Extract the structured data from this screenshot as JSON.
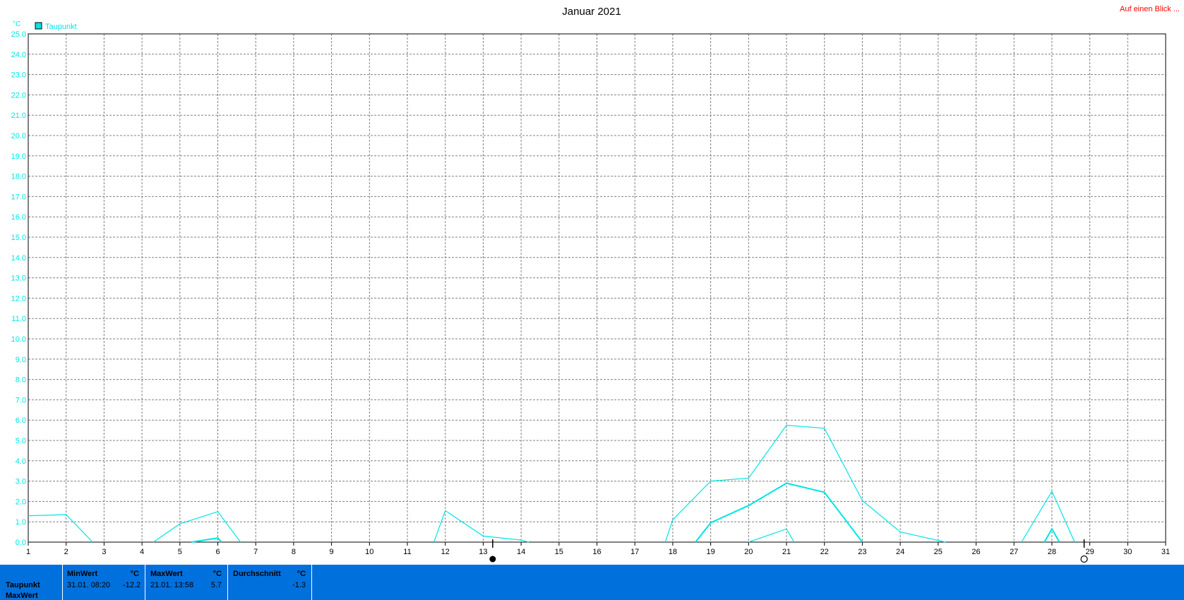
{
  "header": {
    "title": "Januar 2021",
    "link_label": "Auf einen Blick ..."
  },
  "chart_data": {
    "type": "line",
    "title": "Januar 2021",
    "ylabel": "°C",
    "xlabel": "",
    "ylim": [
      0,
      25
    ],
    "xlim": [
      1,
      31
    ],
    "grid": true,
    "legend": "top-left",
    "y_ticks": [
      "0.0",
      "1.0",
      "2.0",
      "3.0",
      "4.0",
      "5.0",
      "6.0",
      "7.0",
      "8.0",
      "9.0",
      "10.0",
      "11.0",
      "12.0",
      "13.0",
      "14.0",
      "15.0",
      "16.0",
      "17.0",
      "18.0",
      "19.0",
      "20.0",
      "21.0",
      "22.0",
      "23.0",
      "24.0",
      "25.0"
    ],
    "x_ticks": [
      "1",
      "2",
      "3",
      "4",
      "5",
      "6",
      "7",
      "8",
      "9",
      "10",
      "11",
      "12",
      "13",
      "14",
      "15",
      "16",
      "17",
      "18",
      "19",
      "20",
      "21",
      "22",
      "23",
      "24",
      "25",
      "26",
      "27",
      "28",
      "29",
      "30",
      "31"
    ],
    "moon_phases": [
      {
        "day": 13.25,
        "phase": "new-moon"
      },
      {
        "day": 28.85,
        "phase": "full-moon"
      }
    ],
    "series": [
      {
        "name": "Taupunkt",
        "color": "#00e5e5",
        "segments": [
          [
            [
              1,
              1.3
            ],
            [
              2,
              1.35
            ],
            [
              2.7,
              0
            ]
          ],
          [
            [
              4.3,
              0
            ],
            [
              5,
              0.9
            ],
            [
              6,
              1.5
            ],
            [
              6.6,
              0
            ]
          ],
          [
            [
              11.7,
              0
            ],
            [
              12,
              1.55
            ],
            [
              13,
              0.3
            ],
            [
              14,
              0.1
            ],
            [
              14.2,
              0
            ]
          ],
          [
            [
              17.8,
              0
            ],
            [
              18,
              1.1
            ],
            [
              19,
              3.0
            ],
            [
              20,
              3.15
            ],
            [
              21,
              5.75
            ],
            [
              22,
              5.6
            ],
            [
              23,
              2.05
            ],
            [
              24,
              0.5
            ],
            [
              25.2,
              0
            ]
          ],
          [
            [
              27.2,
              0
            ],
            [
              28,
              2.5
            ],
            [
              28.6,
              0
            ]
          ]
        ]
      },
      {
        "name": "",
        "color": "#00e5e5",
        "segments": [
          [
            [
              5.3,
              0
            ],
            [
              6,
              0.2
            ],
            [
              6.1,
              0
            ]
          ],
          [
            [
              18.6,
              0
            ],
            [
              19,
              0.95
            ],
            [
              20,
              1.8
            ],
            [
              21,
              2.9
            ],
            [
              22,
              2.45
            ],
            [
              23,
              0
            ]
          ],
          [
            [
              27.8,
              0
            ],
            [
              28,
              0.65
            ],
            [
              28.2,
              0
            ]
          ]
        ]
      },
      {
        "name": "",
        "color": "#00e5e5",
        "segments": [
          [
            [
              20,
              0
            ],
            [
              21,
              0.65
            ],
            [
              21.2,
              0
            ]
          ]
        ]
      }
    ]
  },
  "stats": {
    "row_labels": [
      "Taupunkt",
      "MaxWert"
    ],
    "min": {
      "header": "MinWert",
      "unit": "°C",
      "datetime": "31.01.  08:20",
      "value": "-12.2"
    },
    "max": {
      "header": "MaxWert",
      "unit": "°C",
      "datetime": "21.01.  13:58",
      "value": "5.7"
    },
    "avg": {
      "header": "Durchschnitt",
      "unit": "°C",
      "value": "-1.3"
    }
  }
}
